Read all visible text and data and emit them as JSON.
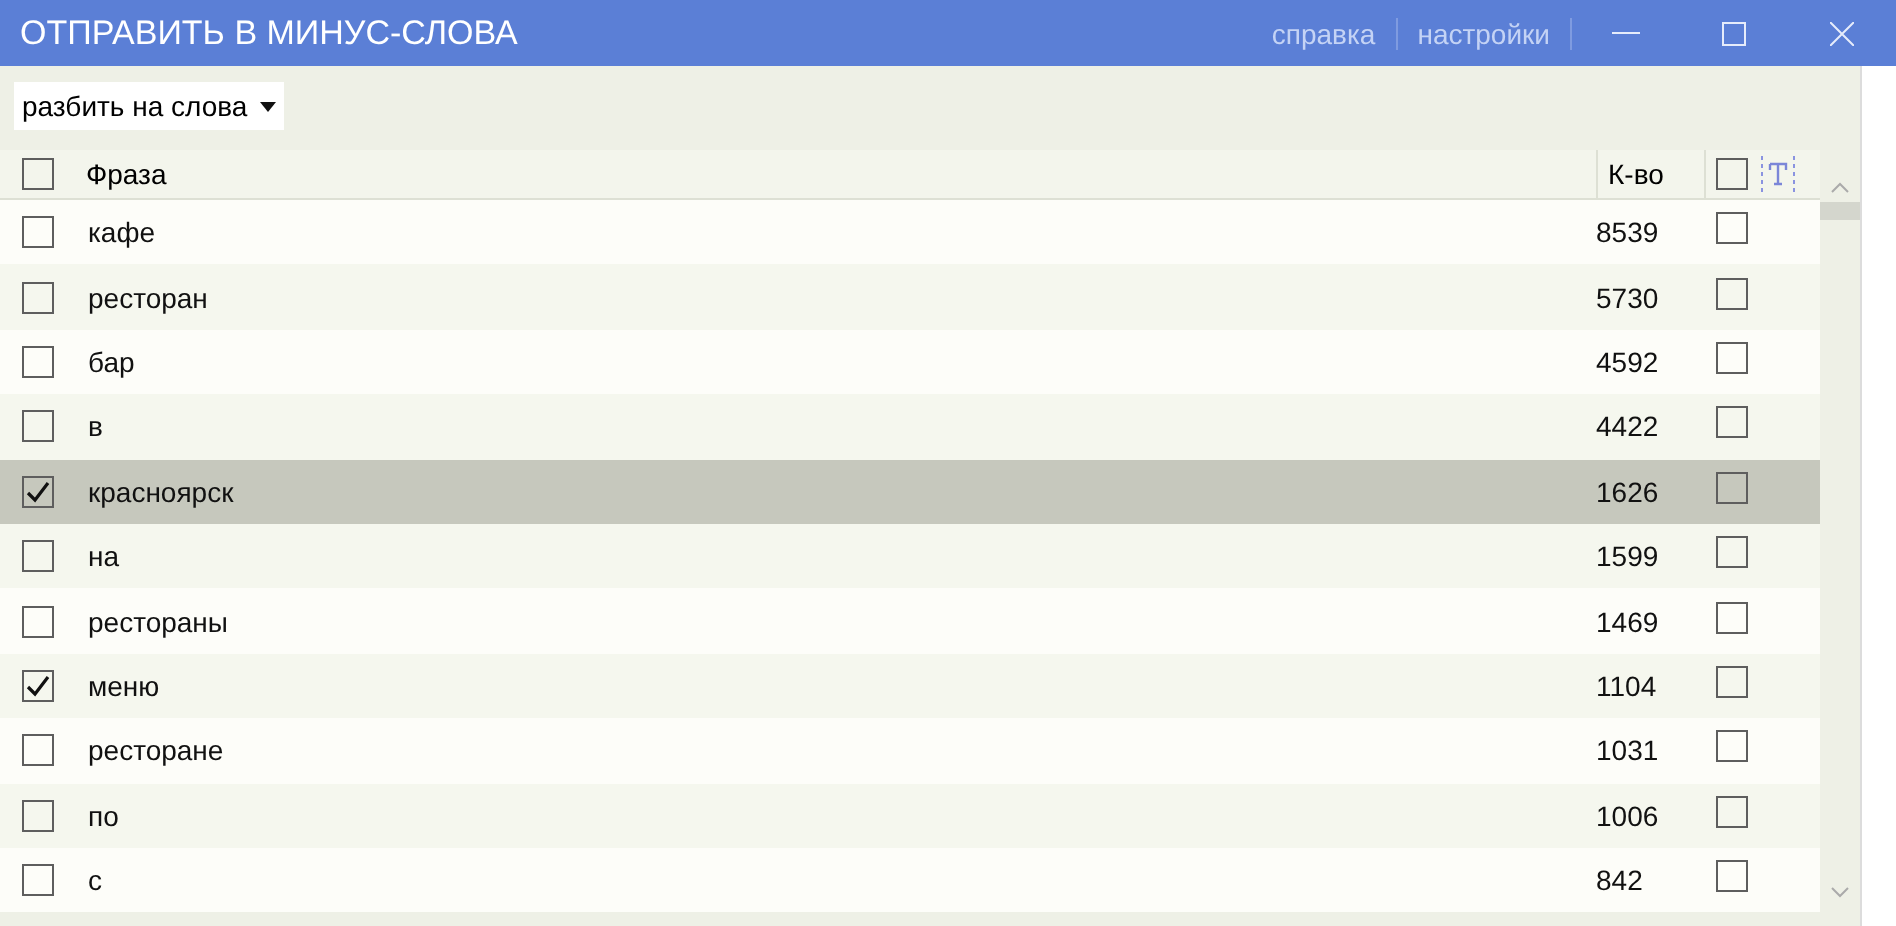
{
  "window": {
    "title": "ОТПРАВИТЬ В МИНУС-СЛОВА",
    "links": [
      "справка",
      "настройки"
    ]
  },
  "toolbar": {
    "mode_dropdown": "разбить на слова"
  },
  "table": {
    "header_checked": false,
    "columns": [
      "Фраза",
      "К-во"
    ],
    "extra_header_checked": false,
    "rows": [
      {
        "phrase": "кафе",
        "count": "8539",
        "checked": false,
        "selected": false,
        "extra_checked": false
      },
      {
        "phrase": "ресторан",
        "count": "5730",
        "checked": false,
        "selected": false,
        "extra_checked": false
      },
      {
        "phrase": "бар",
        "count": "4592",
        "checked": false,
        "selected": false,
        "extra_checked": false
      },
      {
        "phrase": "в",
        "count": "4422",
        "checked": false,
        "selected": false,
        "extra_checked": false
      },
      {
        "phrase": "красноярск",
        "count": "1626",
        "checked": true,
        "selected": true,
        "extra_checked": false
      },
      {
        "phrase": "на",
        "count": "1599",
        "checked": false,
        "selected": false,
        "extra_checked": false
      },
      {
        "phrase": "рестораны",
        "count": "1469",
        "checked": false,
        "selected": false,
        "extra_checked": false
      },
      {
        "phrase": "меню",
        "count": "1104",
        "checked": true,
        "selected": false,
        "extra_checked": false
      },
      {
        "phrase": "ресторане",
        "count": "1031",
        "checked": false,
        "selected": false,
        "extra_checked": false
      },
      {
        "phrase": "по",
        "count": "1006",
        "checked": false,
        "selected": false,
        "extra_checked": false
      },
      {
        "phrase": "с",
        "count": "842",
        "checked": false,
        "selected": false,
        "extra_checked": false
      }
    ]
  }
}
